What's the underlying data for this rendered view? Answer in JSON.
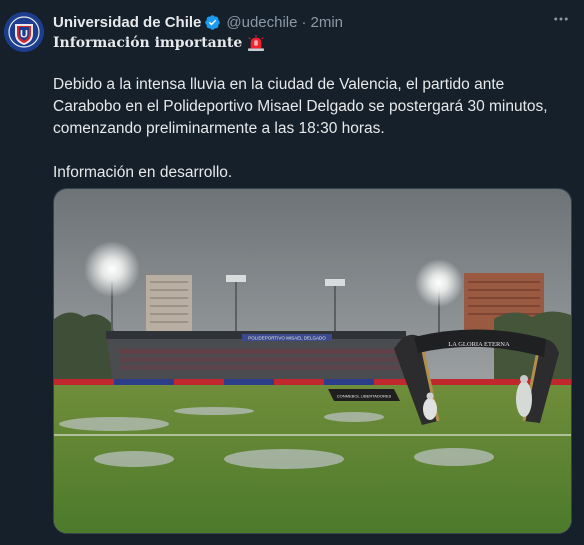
{
  "tweet": {
    "display_name": "Universidad de Chile",
    "handle": "@udechile",
    "separator": "·",
    "timestamp": "2min",
    "more_icon": "more-icon",
    "headline": "Información importante",
    "paragraph1": "Debido a la intensa lluvia en la ciudad de Valencia, el partido ante Carabobo en el Polideportivo Misael Delgado se postergará 30 minutos, comenzando preliminarmente a las 18:30 horas.",
    "paragraph2": "Información en desarrollo."
  },
  "media": {
    "stand_sign": "POLIDEPORTIVO MISAEL DELGADO",
    "arch_text": "LA GLORIA ETERNA",
    "ad_text": "CONMEBOL LIBERTADORES"
  },
  "colors": {
    "background": "#15202b",
    "text": "#e7e9ea",
    "muted": "#8b98a5",
    "verified": "#1d9bf0",
    "club_blue": "#1d3e8f",
    "club_red": "#d7262b"
  }
}
